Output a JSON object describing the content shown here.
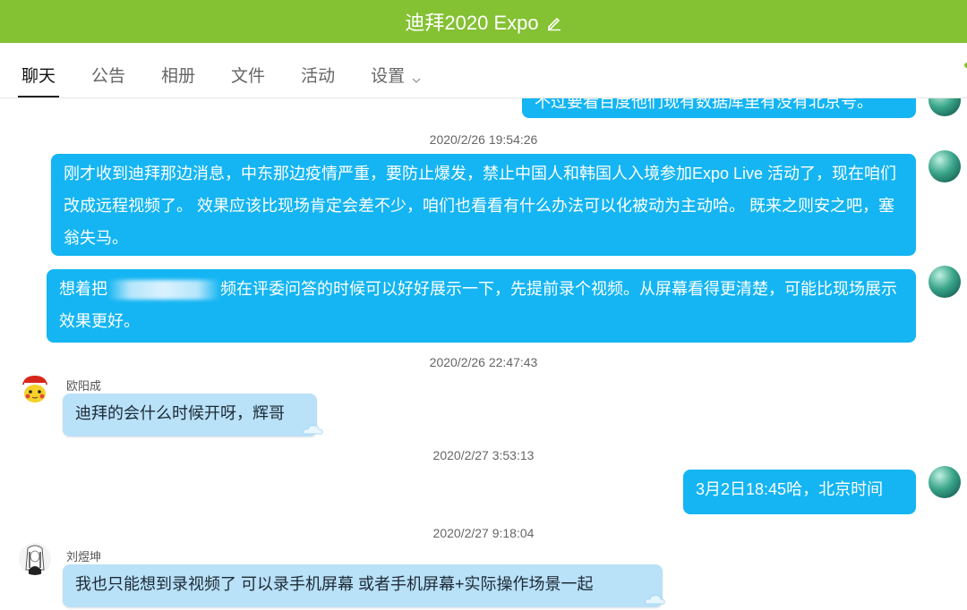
{
  "header": {
    "title": "迪拜2020 Expo",
    "edit_icon": "pencil-icon",
    "bg_color": "#84c133"
  },
  "tabs": [
    {
      "label": "聊天",
      "active": true
    },
    {
      "label": "公告"
    },
    {
      "label": "相册"
    },
    {
      "label": "文件"
    },
    {
      "label": "活动"
    },
    {
      "label": "设置",
      "has_dropdown": true
    }
  ],
  "messages": {
    "top_partial": "不过要看百度他们现有数据库里有没有北京号。",
    "ts1": "2020/2/26 19:54:26",
    "m1": "刚才收到迪拜那边消息，中东那边疫情严重，要防止爆发，禁止中国人和韩国人入境参加Expo Live 活动了，现在咱们改成远程视频了。 效果应该比现场肯定会差不少，咱们也看看有什么办法可以化被动为主动哈。 既来之则安之吧，塞翁失马。",
    "m2_before": "想着把",
    "m2_after": "频在评委问答的时候可以好好展示一下，先提前录个视频。从屏幕看得更清楚，可能比现场展示效果更好。",
    "ts2": "2020/2/26 22:47:43",
    "sender3": "欧阳成",
    "m3": "迪拜的会什么时候开呀，辉哥",
    "ts3": "2020/2/27 3:53:13",
    "m4": "3月2日18:45哈，北京时间",
    "ts4": "2020/2/27 9:18:04",
    "sender5": "刘煜坤",
    "m5": "我也只能想到录视频了 可以录手机屏幕 或者手机屏幕+实际操作场景一起"
  },
  "colors": {
    "outgoing_bubble": "#14b5f2",
    "incoming_bubble": "#b9e1f8"
  }
}
